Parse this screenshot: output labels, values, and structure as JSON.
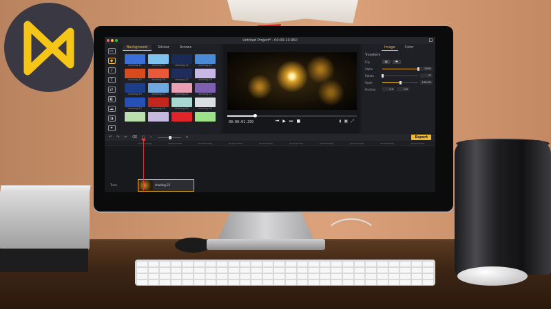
{
  "app": {
    "window_title": "Untitled Project* - 00:00:10.950",
    "sidebar_icons": [
      "media-icon",
      "audio-icon",
      "text-icon",
      "transitions-icon",
      "filters-icon",
      "elements-icon",
      "overlays-icon",
      "background-icon"
    ],
    "library": {
      "tabs": [
        "Background",
        "Sticker",
        "Arrows"
      ],
      "active_tab": "Background",
      "thumbnails": [
        {
          "label": "shading-11",
          "color": "#3a6fd8"
        },
        {
          "label": "shading-12",
          "color": "#7ec3ef"
        },
        {
          "label": "shading-13",
          "color": "#1a2c55"
        },
        {
          "label": "shading-14",
          "color": "#4a8ad6"
        },
        {
          "label": "shading-15",
          "color": "#d94a1e"
        },
        {
          "label": "shading-16",
          "color": "#e8583a"
        },
        {
          "label": "shading-17",
          "color": "#1f2c5c"
        },
        {
          "label": "shading-18",
          "color": "#c7b8e6"
        },
        {
          "label": "shading-19",
          "color": "#1b3d8a"
        },
        {
          "label": "shading-20",
          "color": "#6fa8e0"
        },
        {
          "label": "shading-21",
          "color": "#e9a0b4"
        },
        {
          "label": "shading-22",
          "color": "#7e5fb0"
        },
        {
          "label": "shading-23",
          "color": "#2450b8"
        },
        {
          "label": "shading-24",
          "color": "#c3261c"
        },
        {
          "label": "shading-25",
          "color": "#a7d9d2"
        },
        {
          "label": "shading-26",
          "color": "#dadfe4"
        },
        {
          "label": "",
          "color": "#b9dfae"
        },
        {
          "label": "",
          "color": "#c5b9df"
        },
        {
          "label": "",
          "color": "#e0242a"
        },
        {
          "label": "",
          "color": "#9fe08a"
        }
      ]
    },
    "preview": {
      "timecode": "00:00:01.250",
      "transport": [
        "⏮",
        "▶",
        "⏭",
        "■"
      ]
    },
    "properties": {
      "tabs": [
        "Image",
        "Color"
      ],
      "active_tab": "Image",
      "section": "Transform",
      "rows": [
        {
          "name": "Flip",
          "type": "buttons"
        },
        {
          "name": "Alpha",
          "value": "100%",
          "level": 1.0
        },
        {
          "name": "Rotate",
          "value": "0°",
          "level": 0.0
        },
        {
          "name": "Scale",
          "value": "100.0%",
          "level": 0.5
        },
        {
          "name": "Position",
          "x": "0.0",
          "y": "0.0"
        }
      ]
    },
    "toolbar": {
      "export_label": "Export"
    },
    "ruler_ticks": [
      "00:00:00.000",
      "00:00:01.000",
      "00:00:02.000",
      "00:00:03.000",
      "00:00:04.000",
      "00:00:05.000",
      "00:00:06.000",
      "00:00:07.000",
      "00:00:08.000",
      "00:00:09.000"
    ],
    "timeline": {
      "track_label": "Track",
      "clip_label": "shading-22"
    }
  },
  "colors": {
    "accent": "#f0b72f",
    "playhead": "#e53935",
    "badge_bg": "#3a3843",
    "badge_logo": "#f5c518"
  }
}
